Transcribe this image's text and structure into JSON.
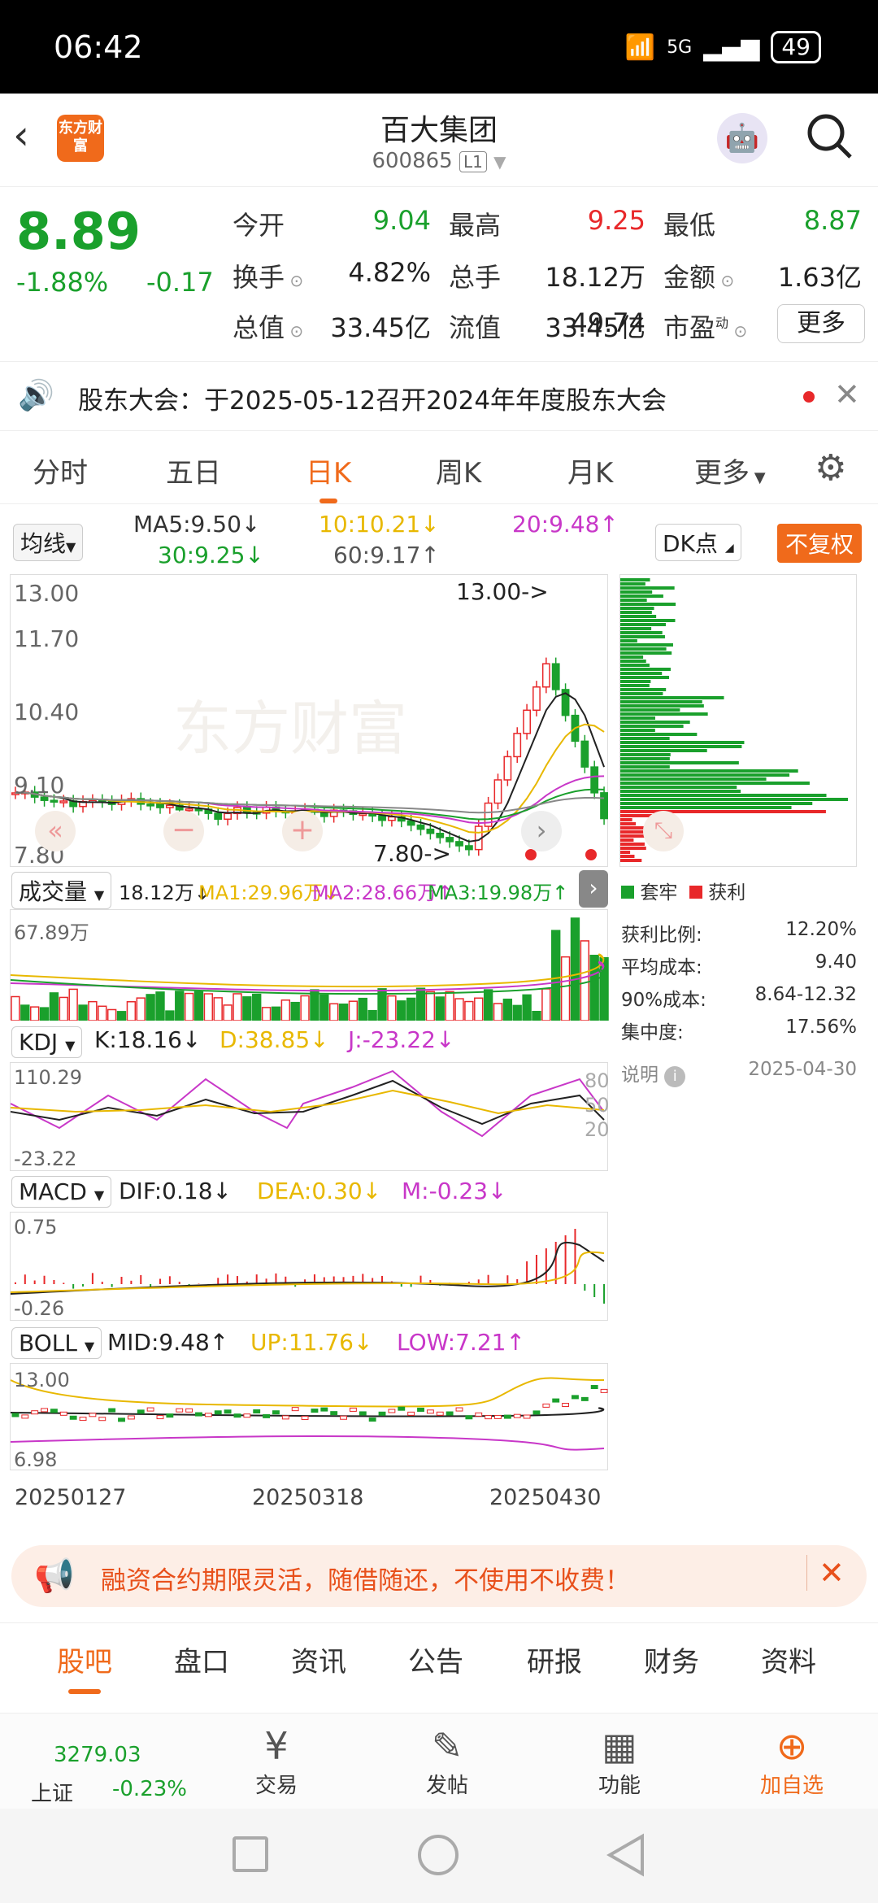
{
  "status": {
    "time": "06:42",
    "network": "5G",
    "battery": "49"
  },
  "header": {
    "logo": "东方财富",
    "title": "百大集团",
    "code": "600865",
    "badge": "L1"
  },
  "quote": {
    "price": "8.89",
    "pct": "-1.88%",
    "chg": "-0.17",
    "rows": [
      [
        {
          "k": "今开",
          "v": "9.04",
          "c": "green"
        },
        {
          "k": "最高",
          "v": "9.25",
          "c": "red"
        },
        {
          "k": "最低",
          "v": "8.87",
          "c": "green"
        }
      ],
      [
        {
          "k": "换手",
          "v": "4.82%",
          "c": ""
        },
        {
          "k": "总手",
          "v": "18.12万",
          "c": ""
        },
        {
          "k": "金额",
          "v": "1.63亿",
          "c": ""
        }
      ],
      [
        {
          "k": "总值",
          "v": "33.45亿",
          "c": ""
        },
        {
          "k": "流值",
          "v": "33.45亿",
          "c": ""
        },
        {
          "k": "市盈",
          "v": "49.74",
          "c": ""
        }
      ]
    ],
    "pe_sup": "动",
    "more": "更多"
  },
  "notice": {
    "text": "股东大会：于2025-05-12召开2024年年度股东大会"
  },
  "tabs": [
    "分时",
    "五日",
    "日K",
    "周K",
    "月K",
    "更多"
  ],
  "ma": {
    "selector": "均线",
    "ma5": "MA5:9.50↓",
    "ma10": "10:10.21↓",
    "ma20": "20:9.48↑",
    "ma30": "30:9.25↓",
    "ma60": "60:9.17↑",
    "dk": "DK点",
    "fq": "不复权"
  },
  "kline": {
    "y_top": "13.00",
    "y_2": "11.70",
    "y_3": "10.40",
    "y_4": "9.10",
    "y_bot": "7.80",
    "hi_mark": "13.00->",
    "lo_mark": "7.80->",
    "watermark": "东方财富"
  },
  "chip": {
    "legend1": "套牢",
    "legend2": "获利",
    "rows": [
      {
        "k": "获利比例:",
        "v": "12.20%"
      },
      {
        "k": "平均成本:",
        "v": "9.40"
      },
      {
        "k": "90%成本:",
        "v": "8.64-12.32"
      },
      {
        "k": "集中度:",
        "v": "17.56%"
      }
    ],
    "note": "说明",
    "date": "2025-04-30"
  },
  "volume": {
    "selector": "成交量",
    "val": "18.12万↓",
    "ma1": "MA1:29.96万↓",
    "ma2": "MA2:28.66万↑",
    "ma3": "MA3:19.98万↑",
    "max": "67.89万"
  },
  "kdj": {
    "selector": "KDJ",
    "k": "K:18.16↓",
    "d": "D:38.85↓",
    "j": "J:-23.22↓",
    "top": "110.29",
    "bot": "-23.22",
    "l80": "80",
    "l50": "50",
    "l20": "20"
  },
  "macd": {
    "selector": "MACD",
    "dif": "DIF:0.18↓",
    "dea": "DEA:0.30↓",
    "m": "M:-0.23↓",
    "top": "0.75",
    "bot": "-0.26"
  },
  "boll": {
    "selector": "BOLL",
    "mid": "MID:9.48↑",
    "up": "UP:11.76↓",
    "low": "LOW:7.21↑",
    "top": "13.00",
    "bot": "6.98"
  },
  "dates": [
    "20250127",
    "20250318",
    "20250430"
  ],
  "banner": {
    "text": "融资合约期限灵活，随借随还，不使用不收费！"
  },
  "ftabs": [
    "股吧",
    "盘口",
    "资讯",
    "公告",
    "研报",
    "财务",
    "资料"
  ],
  "bottom": {
    "index": "3279.03",
    "index_name": "上证",
    "index_pct": "-0.23%",
    "items": [
      "交易",
      "发帖",
      "功能",
      "加自选"
    ]
  },
  "colors": {
    "accent": "#f06a1b",
    "up": "#e8282a",
    "down": "#1aa02c",
    "ma10": "#e8b800",
    "ma20": "#c837c8"
  }
}
